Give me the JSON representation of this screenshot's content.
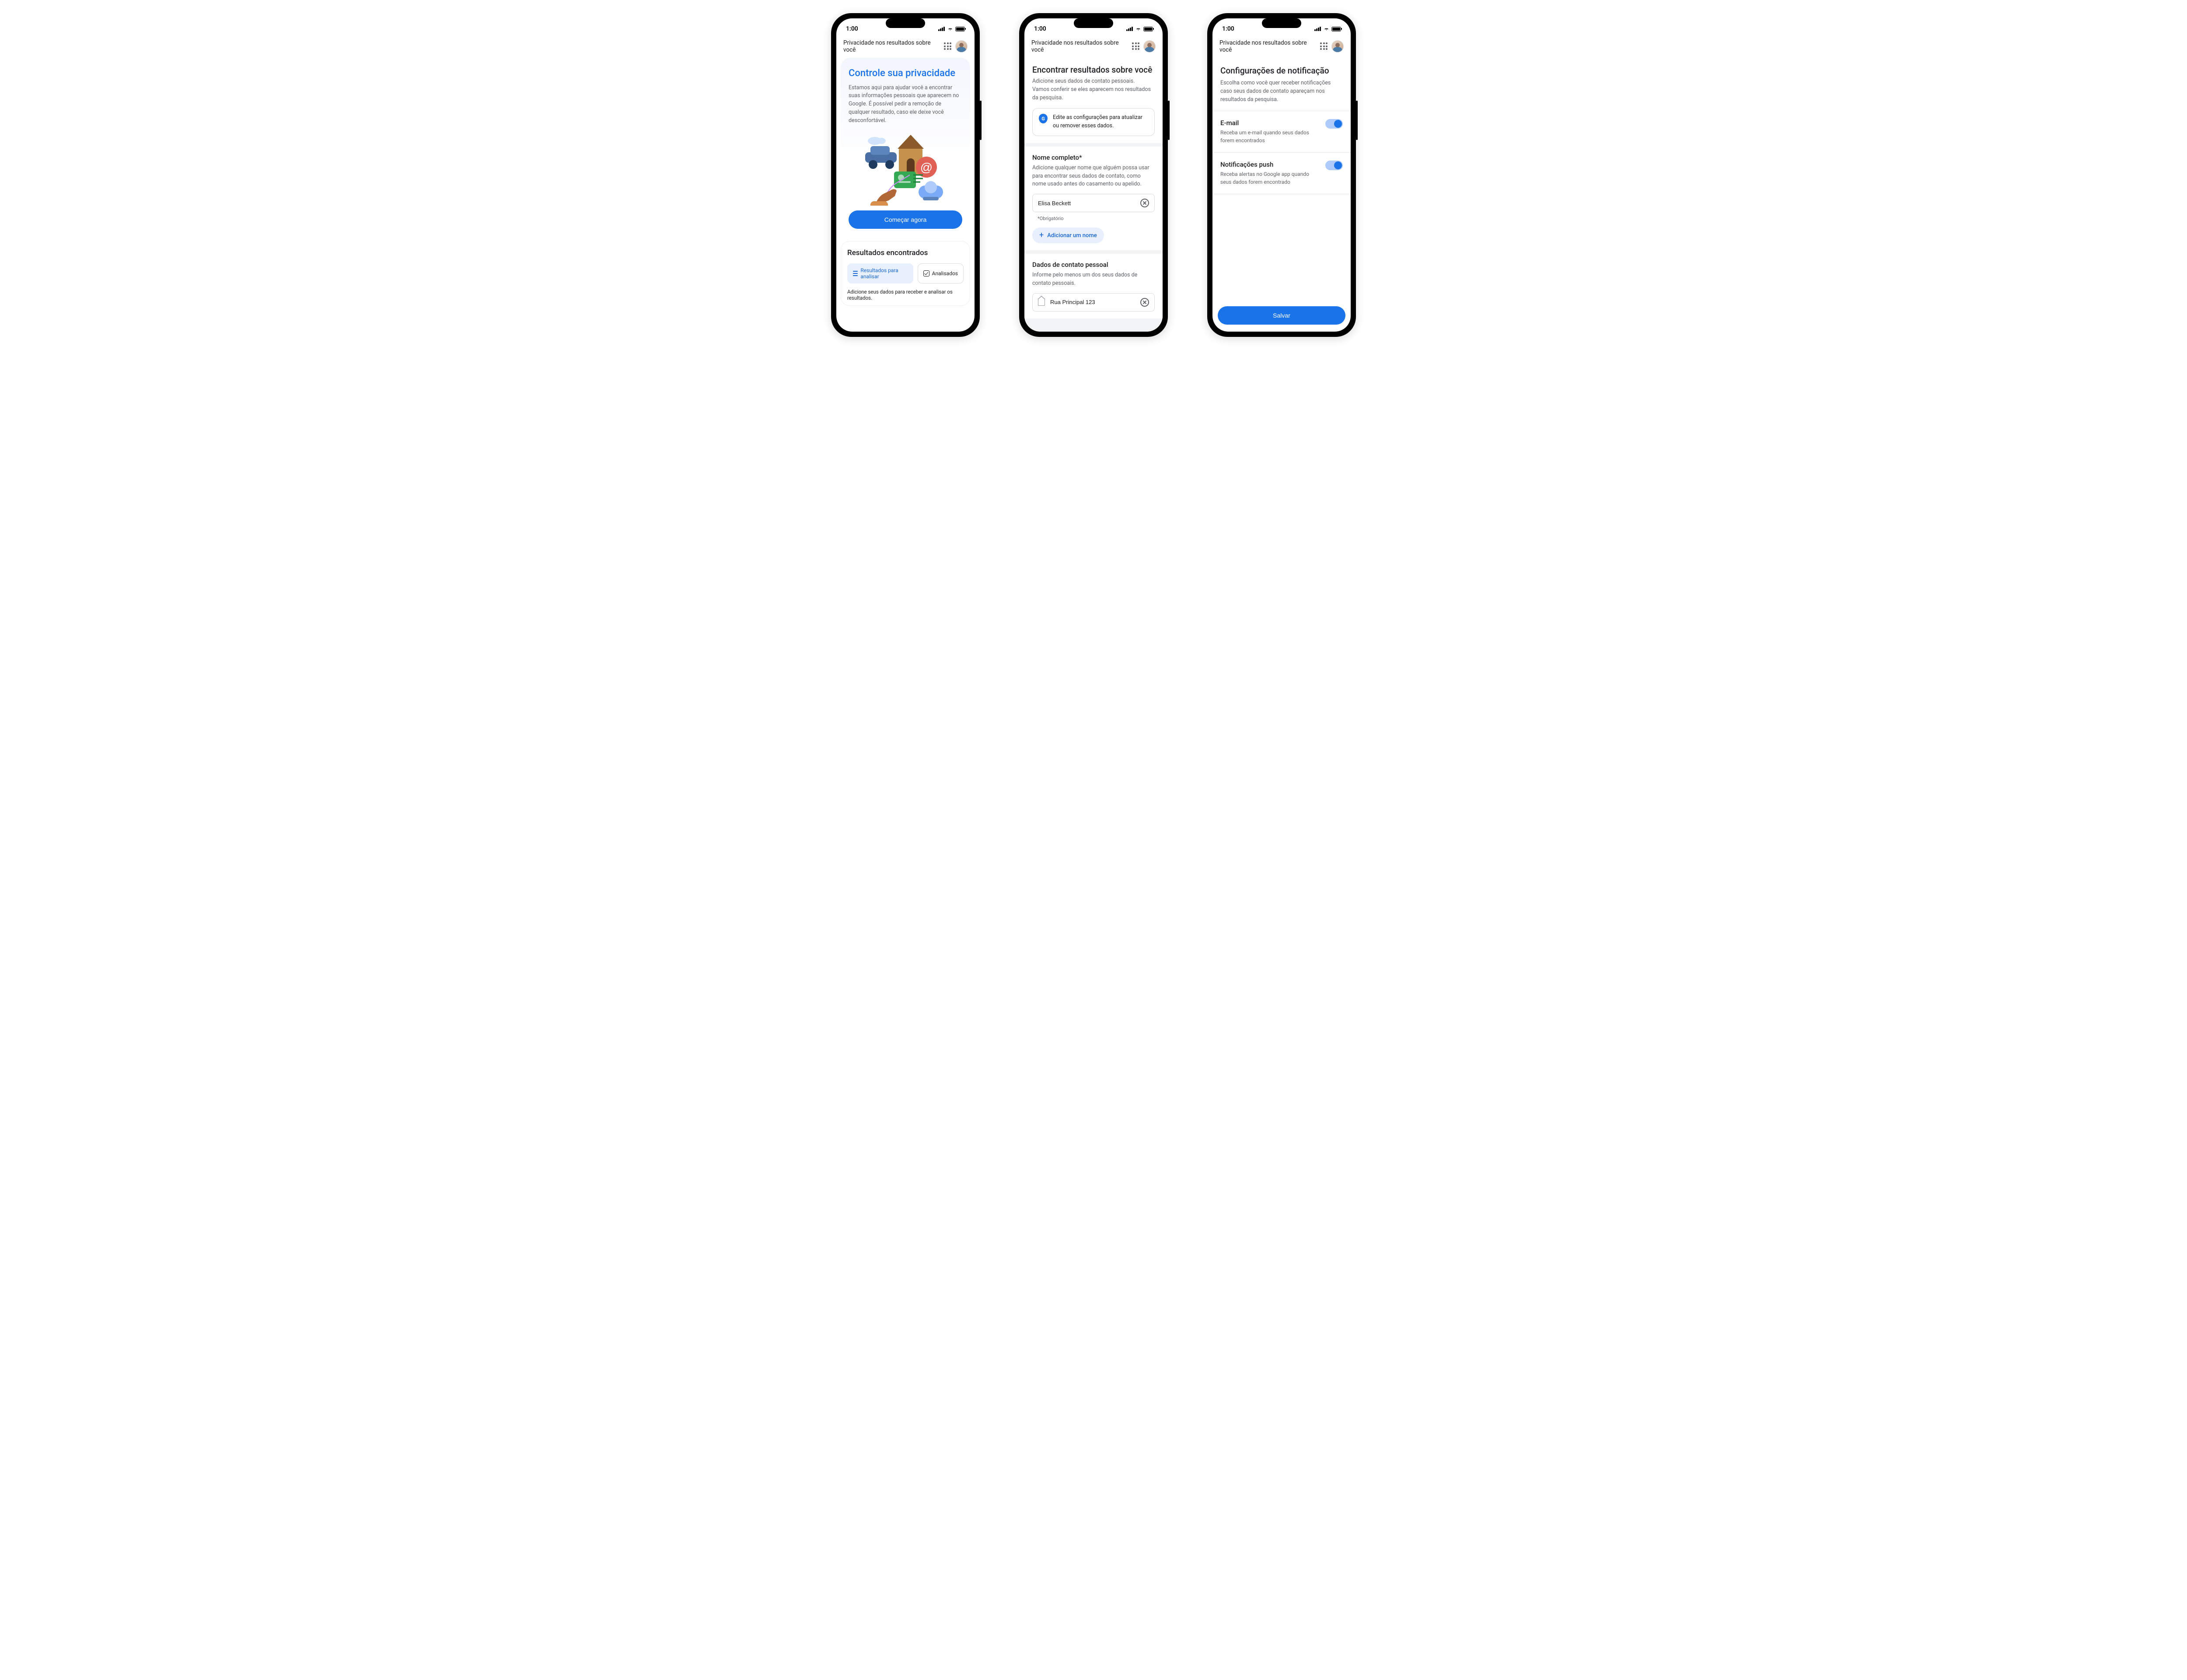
{
  "status": {
    "time": "1:00"
  },
  "header": {
    "title": "Privacidade nos resultados sobre você"
  },
  "s1": {
    "hero_title": "Controle sua privacidade",
    "hero_desc": "Estamos aqui para ajudar você a encontrar suas informações pessoais que aparecem no Google. É possível pedir a remoção de qualquer resultado, caso ele deixe você desconfortável.",
    "cta": "Começar agora",
    "results_title": "Resultados encontrados",
    "chip_review": "Resultados para analisar",
    "chip_reviewed": "Analisados",
    "footer": "Adicione seus dados para receber e analisar os resultados."
  },
  "s2": {
    "h1": "Encontrar resultados sobre você",
    "p1": "Adicione seus dados de contato pessoais.",
    "p2": "Vamos conferir se eles aparecem nos resultados da pesquisa.",
    "info": "Edite as configurações para atualizar ou remover esses dados.",
    "name_label": "Nome completo*",
    "name_hint": "Adicione qualquer nome que alguém possa usar para encontrar seus dados de contato, como nome usado antes do casamento ou apelido.",
    "name_value": "Elisa Beckett",
    "required": "*Obrigatório",
    "add_name": "Adicionar um nome",
    "contact_label": "Dados de contato pessoal",
    "contact_hint": "Informe pelo menos um dos seus dados de contato pessoais.",
    "address_value": "Rua Principal 123"
  },
  "s3": {
    "h1": "Configurações de notificação",
    "sub": "Escolha como você quer receber notificações caso seus dados de contato apareçam nos resultados da pesquisa.",
    "email_label": "E-mail",
    "email_desc": "Receba um e-mail quando seus dados forem encontrados",
    "push_label": "Notificações push",
    "push_desc": "Receba alertas no Google app quando seus dados forem encontrado",
    "save": "Salvar"
  }
}
